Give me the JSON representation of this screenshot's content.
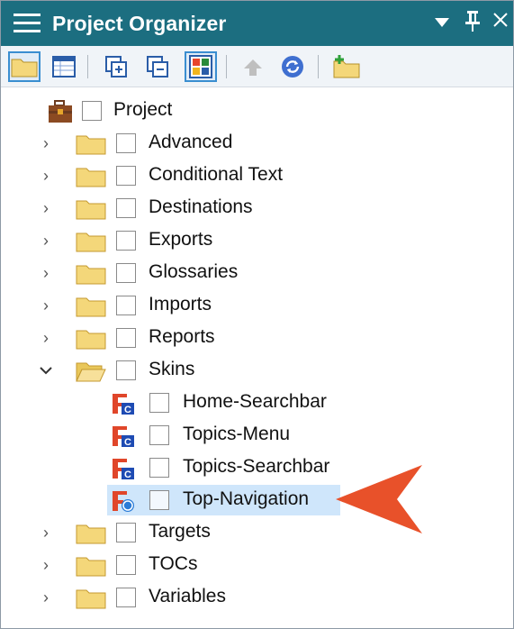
{
  "window": {
    "title": "Project Organizer",
    "icons": [
      "hamburger-menu-icon",
      "dropdown-arrow-icon",
      "pin-icon",
      "close-icon"
    ]
  },
  "toolbar": {
    "buttons": [
      {
        "name": "folder-view-button",
        "icon": "folder-icon",
        "selected": true
      },
      {
        "name": "list-view-button",
        "icon": "grid-list-icon",
        "selected": false
      },
      {
        "name": "expand-all-button",
        "icon": "expand-icon",
        "selected": false
      },
      {
        "name": "collapse-all-button",
        "icon": "collapse-icon",
        "selected": false
      },
      {
        "name": "color-view-button",
        "icon": "color-grid-icon",
        "selected": true
      },
      {
        "name": "move-up-button",
        "icon": "up-arrow-icon",
        "selected": false
      },
      {
        "name": "refresh-button",
        "icon": "refresh-icon",
        "selected": false
      },
      {
        "name": "new-folder-button",
        "icon": "new-folder-icon",
        "selected": false
      }
    ]
  },
  "tree": {
    "root": {
      "label": "Project",
      "icon": "briefcase-icon"
    },
    "items": [
      {
        "label": "Advanced",
        "expanded": false
      },
      {
        "label": "Conditional Text",
        "expanded": false
      },
      {
        "label": "Destinations",
        "expanded": false
      },
      {
        "label": "Exports",
        "expanded": false
      },
      {
        "label": "Glossaries",
        "expanded": false
      },
      {
        "label": "Imports",
        "expanded": false
      },
      {
        "label": "Reports",
        "expanded": false
      },
      {
        "label": "Skins",
        "expanded": true,
        "children": [
          {
            "label": "Home-Searchbar",
            "icon": "skin-component-icon",
            "selected": false
          },
          {
            "label": "Topics-Menu",
            "icon": "skin-component-icon",
            "selected": false
          },
          {
            "label": "Topics-Searchbar",
            "icon": "skin-component-icon",
            "selected": false
          },
          {
            "label": "Top-Navigation",
            "icon": "skin-navigation-icon",
            "selected": true
          }
        ]
      },
      {
        "label": "Targets",
        "expanded": false
      },
      {
        "label": "TOCs",
        "expanded": false
      },
      {
        "label": "Variables",
        "expanded": false
      }
    ]
  },
  "colors": {
    "titlebar": "#1c6e80",
    "selection": "#cfe6fb",
    "callout_arrow": "#e8512a",
    "folder": "#f4d77a",
    "skin_red": "#e0462a",
    "skin_blue": "#1e4bb3"
  }
}
